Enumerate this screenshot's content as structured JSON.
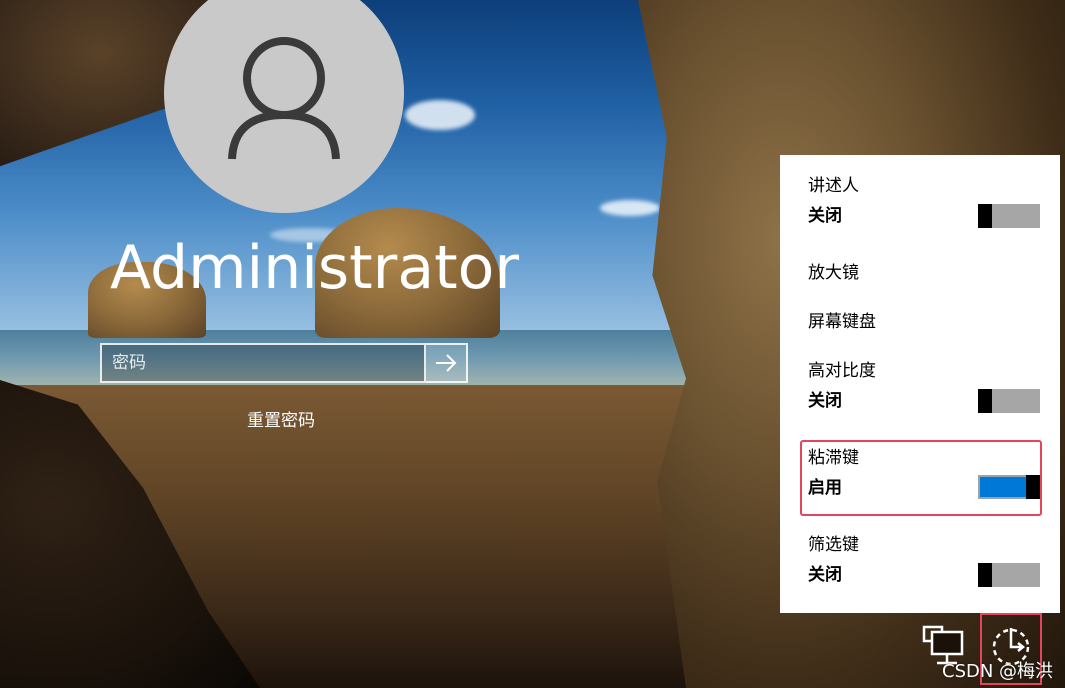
{
  "login": {
    "username": "Administrator",
    "password_placeholder": "密码",
    "reset_password": "重置密码"
  },
  "ease_of_access": {
    "items": [
      {
        "title": "讲述人",
        "state": "关闭",
        "toggle": "off"
      },
      {
        "title": "放大镜"
      },
      {
        "title": "屏幕键盘"
      },
      {
        "title": "高对比度",
        "state": "关闭",
        "toggle": "off"
      },
      {
        "title": "粘滞键",
        "state": "启用",
        "toggle": "on"
      },
      {
        "title": "筛选键",
        "state": "关闭",
        "toggle": "off"
      }
    ]
  },
  "taskbar": {
    "icons": [
      "network-icon",
      "ease-of-access-icon"
    ]
  },
  "watermark": "CSDN @梅洪",
  "colors": {
    "toggle_on": "#0078d7",
    "toggle_off": "#a6a6a6",
    "highlight": "#e5455c"
  }
}
